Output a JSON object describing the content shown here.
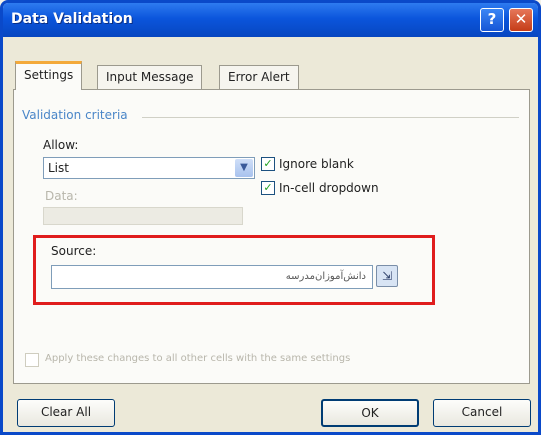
{
  "window": {
    "title": "Data Validation"
  },
  "titlebar": {
    "help_label": "?",
    "close_label": "✕"
  },
  "tabs": [
    {
      "label": "Settings"
    },
    {
      "label": "Input Message"
    },
    {
      "label": "Error Alert"
    }
  ],
  "settings": {
    "group_label": "Validation criteria",
    "allow": {
      "label": "Allow:",
      "value": "List"
    },
    "ignore_blank": {
      "label": "Ignore blank",
      "checked": true
    },
    "in_cell_dropdown": {
      "label": "In-cell dropdown",
      "checked": true
    },
    "data": {
      "label": "Data:"
    },
    "source": {
      "label": "Source:",
      "value": "دانش‌آموزان‌مدرسه"
    },
    "apply_all": {
      "label": "Apply these changes to all other cells with the same settings"
    }
  },
  "buttons": {
    "clear_all": "Clear All",
    "ok": "OK",
    "cancel": "Cancel"
  },
  "icons": {
    "check": "✓",
    "dropdown_arrow": "▼",
    "range_ref": "⇲"
  },
  "colors": {
    "highlight": "#e01d1d",
    "titlebar": "#0b55dc",
    "group_label": "#4a86c8"
  }
}
